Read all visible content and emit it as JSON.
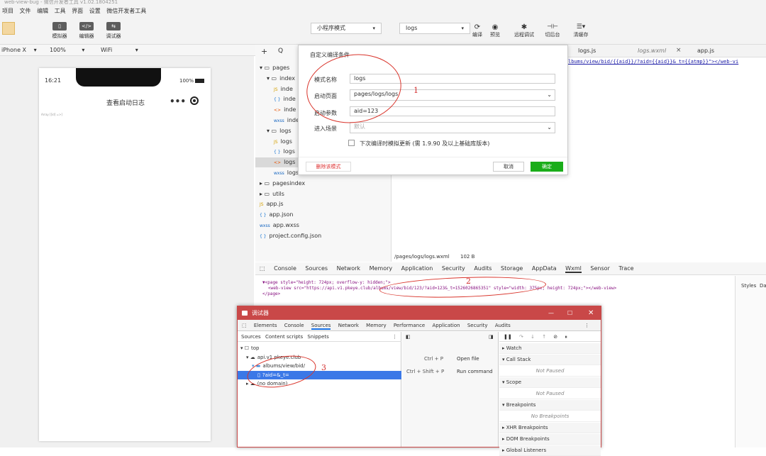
{
  "window": {
    "title": "web-view-bug - 微信开发者工具 v1.02.1804251",
    "menu": [
      "项目",
      "文件",
      "编辑",
      "工具",
      "界面",
      "设置",
      "微信开发者工具"
    ]
  },
  "toolbar": {
    "simulator_label": "模拟器",
    "editor_label": "编辑器",
    "debugger_label": "调试器",
    "mode_select": "小程序模式",
    "compile_select": "logs",
    "compile_label": "编译",
    "preview_label": "预览",
    "remote_debug_label": "远程调试",
    "background_label": "切后台",
    "clear_cache_label": "清缓存"
  },
  "simulator": {
    "device": "iPhone X",
    "zoom": "100%",
    "network": "WiFi",
    "time": "16:21",
    "battery": "100%",
    "page_title": "查看启动日志",
    "body_text": "Array [[id] =>]"
  },
  "filetree": {
    "add": "+",
    "search": "Q",
    "items": [
      {
        "label": "pages",
        "indent": 0,
        "type": "folder-open"
      },
      {
        "label": "index",
        "indent": 1,
        "type": "folder-open"
      },
      {
        "label": "inde",
        "indent": 2,
        "type": "js"
      },
      {
        "label": "inde",
        "indent": 2,
        "type": "json"
      },
      {
        "label": "inde",
        "indent": 2,
        "type": "wxml"
      },
      {
        "label": "inde",
        "indent": 2,
        "type": "wxss"
      },
      {
        "label": "logs",
        "indent": 1,
        "type": "folder-open"
      },
      {
        "label": "logs",
        "indent": 2,
        "type": "js"
      },
      {
        "label": "logs",
        "indent": 2,
        "type": "json"
      },
      {
        "label": "logs",
        "indent": 2,
        "type": "wxml",
        "selected": true
      },
      {
        "label": "logs",
        "indent": 2,
        "type": "wxss"
      },
      {
        "label": "pagesindex",
        "indent": 0,
        "type": "folder"
      },
      {
        "label": "utils",
        "indent": 0,
        "type": "folder"
      },
      {
        "label": "app.js",
        "indent": 0,
        "type": "js"
      },
      {
        "label": "app.json",
        "indent": 0,
        "type": "json"
      },
      {
        "label": "app.wxss",
        "indent": 0,
        "type": "wxss"
      },
      {
        "label": "project.config.json",
        "indent": 0,
        "type": "json"
      }
    ]
  },
  "editor": {
    "tabs": [
      "logs.js",
      "logs.wxml",
      "app.js"
    ],
    "code_line": "lbums/view/bid/{{aid}}/?aid={{aid}}&_t={{atmp}}\"></web-vi",
    "status_path": "/pages/logs/logs.wxml",
    "status_size": "102 B"
  },
  "dialog": {
    "title": "自定义编译条件",
    "name_label": "模式名称",
    "name_value": "logs",
    "page_label": "启动页面",
    "page_value": "pages/logs/logs",
    "params_label": "启动参数",
    "params_value": "aid=123",
    "scene_label": "进入场景",
    "scene_placeholder": "默认",
    "checkbox_label": "下次编译时模拟更新 (需 1.9.90 及以上基础库版本)",
    "delete_label": "删除该模式",
    "cancel_label": "取消",
    "ok_label": "确定"
  },
  "devtools": {
    "tabs": [
      "Console",
      "Sources",
      "Network",
      "Memory",
      "Application",
      "Security",
      "Audits",
      "Storage",
      "AppData",
      "Wxml",
      "Sensor",
      "Trace"
    ],
    "active_tab": "Wxml",
    "wxml_line1": "▼<page style=\"height: 724px; overflow-y: hidden;\">",
    "wxml_line2": "<web-view src=\"https://api.v1.pkeye.club/albums/view/bid/123/?aid=123&_t=1526026865351\" style=\"width: 375px; height: 724px;\"></web-view>",
    "wxml_line3": "</page>",
    "styles_label": "Styles",
    "styles_label2": "Da"
  },
  "debugger": {
    "title": "调试器",
    "tabs": [
      "Elements",
      "Console",
      "Sources",
      "Network",
      "Memory",
      "Performance",
      "Application",
      "Security",
      "Audits"
    ],
    "active_tab": "Sources",
    "subtabs": [
      "Sources",
      "Content scripts",
      "Snippets"
    ],
    "tree": [
      {
        "label": "top",
        "indent": 0
      },
      {
        "label": "api.v1.pkeye.club",
        "indent": 1
      },
      {
        "label": "albums/view/bid/",
        "indent": 2
      },
      {
        "label": "?aid=&_t=",
        "indent": 3,
        "selected": true
      },
      {
        "label": "(no domain)",
        "indent": 1
      }
    ],
    "shortcut1_keys": "Ctrl + P",
    "shortcut1_action": "Open file",
    "shortcut2_keys": "Ctrl + Shift + P",
    "shortcut2_action": "Run command",
    "right_sections": [
      "Watch",
      "Call Stack",
      "Not Paused",
      "Scope",
      "Not Paused",
      "Breakpoints",
      "No Breakpoints",
      "XHR Breakpoints",
      "DOM Breakpoints",
      "Global Listeners"
    ]
  },
  "annotations": {
    "a1": "1",
    "a2": "2",
    "a3": "3"
  }
}
